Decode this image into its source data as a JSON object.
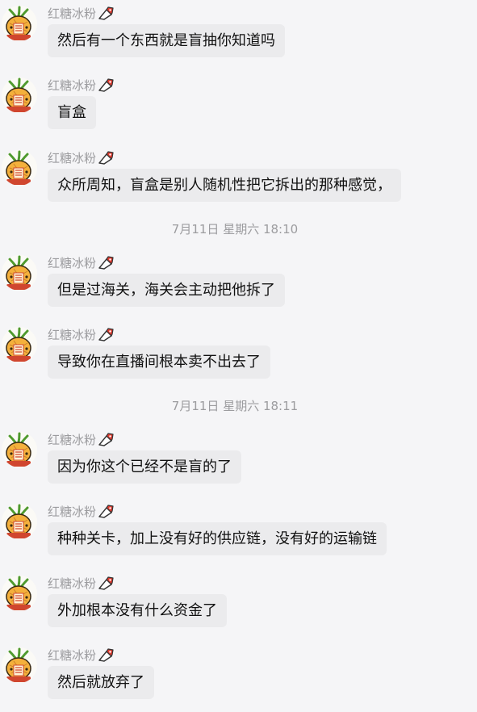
{
  "chat": {
    "messages": [
      {
        "sender": "红糖冰粉",
        "text": "然后有一个东西就是盲抽你知道吗"
      },
      {
        "sender": "红糖冰粉",
        "text": "盲盒"
      },
      {
        "sender": "红糖冰粉",
        "text": "众所周知，盲盒是别人随机性把它拆出的那种感觉，"
      },
      {
        "sender": "红糖冰粉",
        "text": "但是过海关，海关会主动把他拆了"
      },
      {
        "sender": "红糖冰粉",
        "text": "导致你在直播间根本卖不出去了"
      },
      {
        "sender": "红糖冰粉",
        "text": "因为你这个已经不是盲的了"
      },
      {
        "sender": "红糖冰粉",
        "text": "种种关卡，加上没有好的供应链，没有好的运输链"
      },
      {
        "sender": "红糖冰粉",
        "text": "外加根本没有什么资金了"
      },
      {
        "sender": "红糖冰粉",
        "text": "然后就放弃了"
      }
    ],
    "timestamps": [
      "7月11日 星期六 18:10",
      "7月11日 星期六 18:11"
    ]
  },
  "icons": {
    "avatar": "pineapple-avatar-icon",
    "badge": "tag-badge-icon"
  },
  "colors": {
    "background": "#f5f5f7",
    "bubble": "#ebebed",
    "meta_text": "#9c9c9f",
    "message_text": "#111111",
    "badge_red": "#e03a2f"
  }
}
